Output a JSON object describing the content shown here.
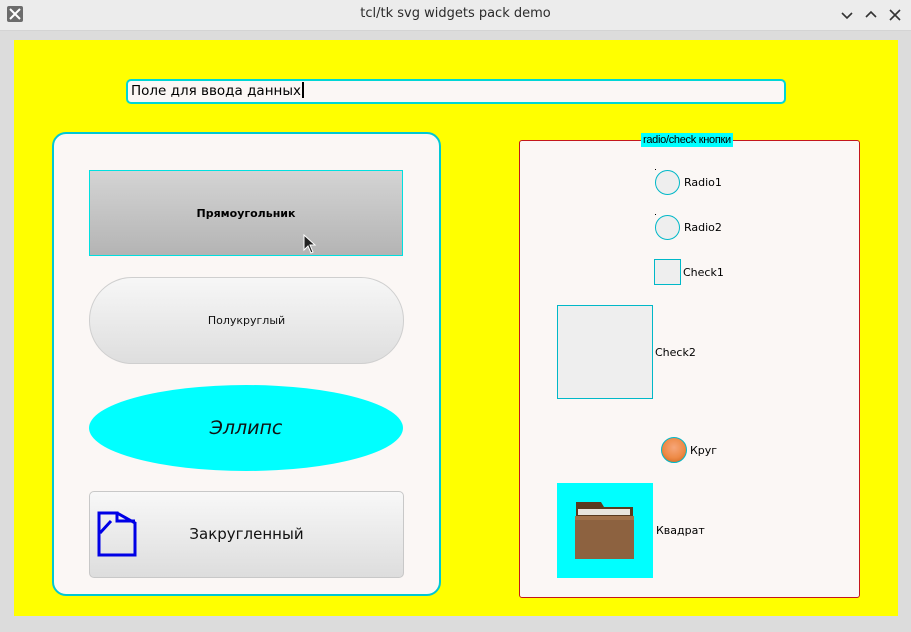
{
  "window": {
    "title": "tcl/tk svg widgets pack demo"
  },
  "entry": {
    "value": "Поле для ввода данных"
  },
  "buttons": {
    "rect_label": "Прямоугольник",
    "pill_label": "Полукруглый",
    "ellipse_label": "Эллипс",
    "rounded_label": "Закругленный"
  },
  "group": {
    "legend": "radio/check кнопки",
    "radio1": "Radio1",
    "radio2": "Radio2",
    "check1": "Check1",
    "check2": "Check2",
    "circle": "Круг",
    "square": "Квадрат"
  },
  "colors": {
    "background": "#ffff00",
    "accent": "#00ffff",
    "frame_border": "#c4161c"
  },
  "icons": [
    "app-icon",
    "minimize-icon",
    "maximize-icon",
    "close-icon",
    "document-icon",
    "circle-icon",
    "folder-icon",
    "mouse-cursor-icon"
  ]
}
